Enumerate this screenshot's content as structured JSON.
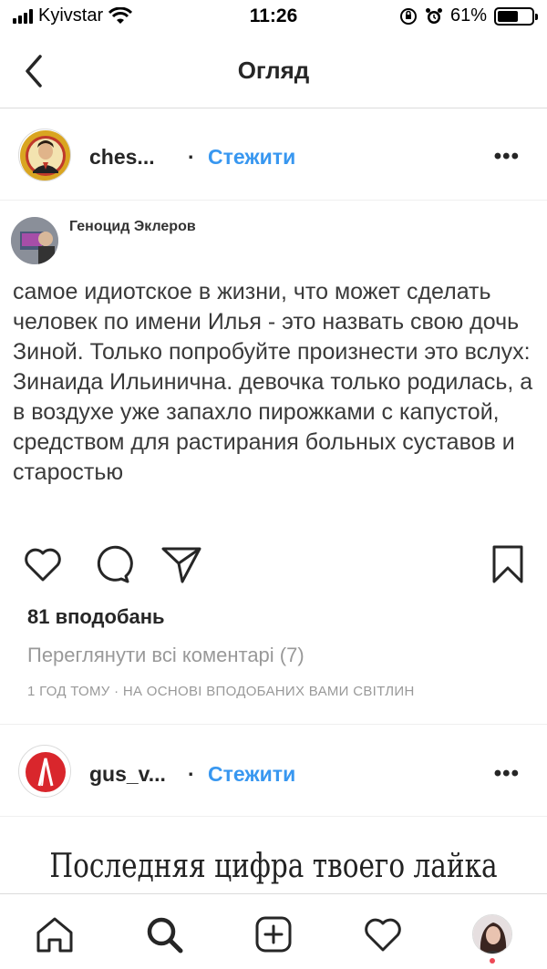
{
  "status_bar": {
    "carrier": "Kyivstar",
    "time": "11:26",
    "battery": "61%",
    "battery_level": 0.61
  },
  "nav": {
    "title": "Огляд",
    "back_icon": "chevron-left-icon"
  },
  "posts": [
    {
      "username": "ches...",
      "dot": "·",
      "follow_label": "Стежити",
      "more_label": "•••"
    },
    {
      "username": "gus_v...",
      "dot": "·",
      "follow_label": "Стежити",
      "more_label": "•••"
    }
  ],
  "tweet": {
    "author": "Геноцид Эклеров",
    "text": "самое идиотское в жизни, что может сделать человек по имени Илья - это назвать свою дочь Зиной. Только попробуйте произнести это вслух: Зинаида Ильинична. девочка только родилась, а в воздухе уже запахло пирожками с капустой, средством для растирания больных суставов и старостью"
  },
  "actions": {
    "icons": [
      "heart-icon",
      "comment-icon",
      "share-icon",
      "bookmark-icon"
    ],
    "likes": "81 вподобань",
    "comments_link": "Переглянути всі коментарі (7)",
    "meta": "1 ГОД ТОМУ · НА ОСНОВІ ВПОДОБАНИХ ВАМИ СВІТЛИН"
  },
  "next_post_preview": "Последняя цифра твоего лайка",
  "tab_bar": {
    "icons": [
      "home-icon",
      "search-icon",
      "new-post-icon",
      "activity-heart-icon",
      "profile-avatar"
    ],
    "accent": "#ed4956"
  },
  "colors": {
    "link": "#3897f0",
    "muted": "#999999",
    "text": "#262626"
  }
}
